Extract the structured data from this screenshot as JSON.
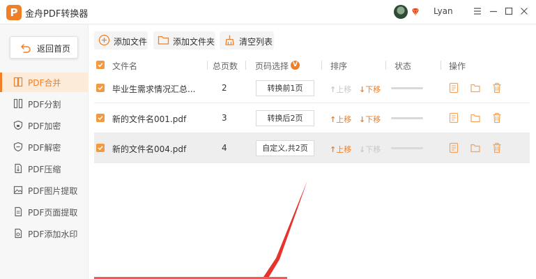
{
  "app": {
    "logo_letter": "P",
    "title": "金舟PDF转换器",
    "username": "Lyan",
    "accent_color": "#f07f26"
  },
  "sidebar": {
    "home_label": "返回首页",
    "items": [
      {
        "label": "PDF合并",
        "icon": "merge-icon",
        "active": true
      },
      {
        "label": "PDF分割",
        "icon": "split-icon",
        "active": false
      },
      {
        "label": "PDF加密",
        "icon": "shield-lock-icon",
        "active": false
      },
      {
        "label": "PDF解密",
        "icon": "shield-unlock-icon",
        "active": false
      },
      {
        "label": "PDF压缩",
        "icon": "compress-icon",
        "active": false
      },
      {
        "label": "PDF图片提取",
        "icon": "image-extract-icon",
        "active": false
      },
      {
        "label": "PDF页面提取",
        "icon": "page-extract-icon",
        "active": false
      },
      {
        "label": "PDF添加水印",
        "icon": "watermark-icon",
        "active": false
      }
    ]
  },
  "toolbar": {
    "add_file": "添加文件",
    "add_folder": "添加文件夹",
    "clear_list": "清空列表"
  },
  "table": {
    "headers": {
      "filename": "文件名",
      "total_pages": "总页数",
      "page_select": "页码选择",
      "page_select_badge": "V",
      "sort": "排序",
      "status": "状态",
      "actions": "操作"
    },
    "move_up": "上移",
    "move_down": "下移",
    "rows": [
      {
        "filename": "毕业生需求情况汇总...",
        "pages": "2",
        "page_select": "转换前1页",
        "up_enabled": false,
        "down_enabled": true
      },
      {
        "filename": "新的文件名001.pdf",
        "pages": "3",
        "page_select": "转换后2页",
        "up_enabled": true,
        "down_enabled": true
      },
      {
        "filename": "新的文件名004.pdf",
        "pages": "4",
        "page_select": "自定义,共2页",
        "up_enabled": true,
        "down_enabled": false,
        "selected": true
      }
    ]
  }
}
